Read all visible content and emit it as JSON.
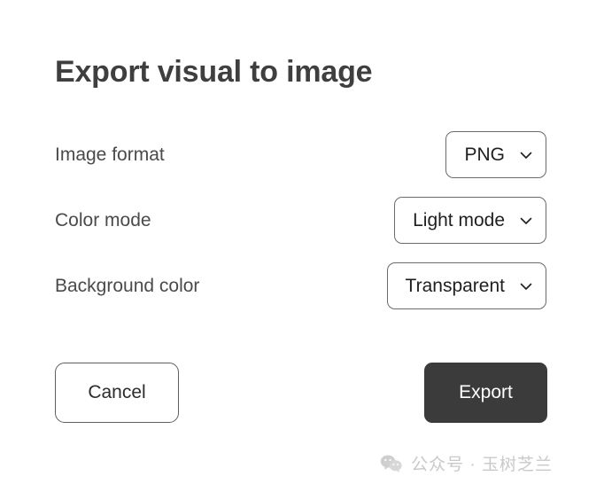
{
  "dialog": {
    "title": "Export visual to image",
    "rows": [
      {
        "label": "Image format",
        "value": "PNG",
        "icon": "chevron-down-icon"
      },
      {
        "label": "Color mode",
        "value": "Light mode",
        "icon": "chevron-down-icon"
      },
      {
        "label": "Background color",
        "value": "Transparent",
        "icon": "chevron-down-icon"
      }
    ],
    "actions": {
      "cancel_label": "Cancel",
      "export_label": "Export"
    }
  },
  "watermark": {
    "icon": "wechat-icon",
    "text": "公众号 · 玉树芝兰"
  },
  "colors": {
    "background": "#ffffff",
    "title_text": "#3f3f3f",
    "label_text": "#4a4a4a",
    "value_text": "#1f1f1f",
    "border": "#6b6b6b",
    "primary_button_bg": "#3b3b3b",
    "primary_button_text": "#ffffff",
    "watermark_text": "#c9c9c9"
  }
}
